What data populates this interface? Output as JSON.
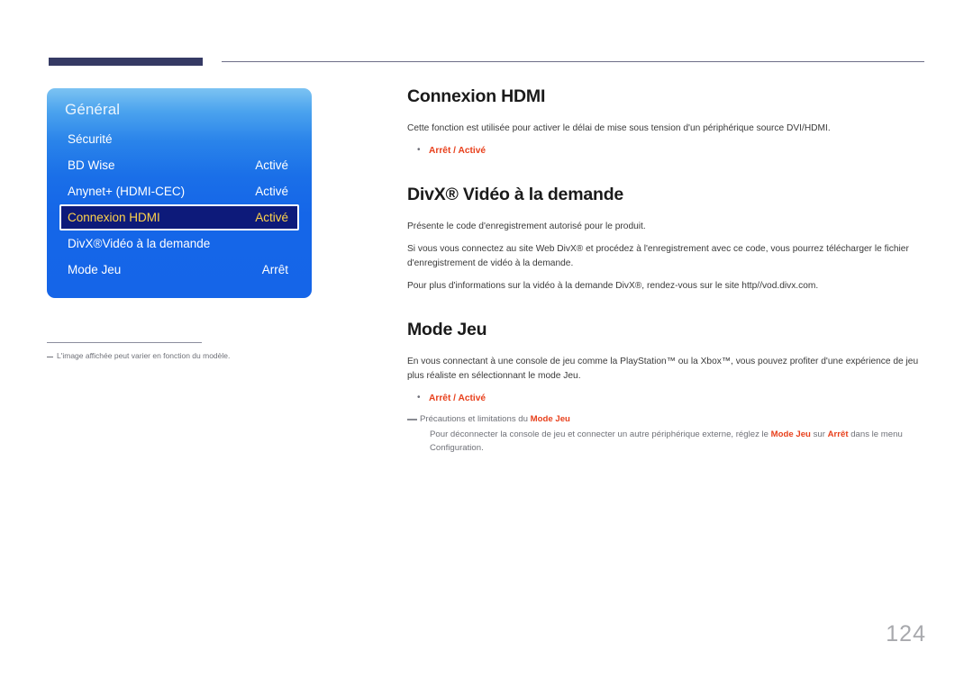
{
  "page": {
    "number": "124"
  },
  "osd": {
    "title": "Général",
    "rows": [
      {
        "label": "Sécurité",
        "value": "",
        "selected": false
      },
      {
        "label": "BD Wise",
        "value": "Activé",
        "selected": false
      },
      {
        "label": "Anynet+ (HDMI-CEC)",
        "value": "Activé",
        "selected": false
      },
      {
        "label": "Connexion HDMI",
        "value": "Activé",
        "selected": true
      },
      {
        "label": "DivX®Vidéo à la demande",
        "value": "",
        "selected": false
      },
      {
        "label": "Mode Jeu",
        "value": "Arrêt",
        "selected": false
      }
    ],
    "footnote": "L'image affichée peut varier en fonction du modèle.",
    "colors": {
      "panel_top": "#7cc3f2",
      "panel_bottom": "#1565e8",
      "selected_bg": "#0d1a7a",
      "selected_text": "#ffd24a"
    }
  },
  "sections": {
    "hdmi": {
      "heading": "Connexion HDMI",
      "paragraph": "Cette fonction est utilisée pour activer le délai de mise sous tension d'un périphérique source DVI/HDMI.",
      "bullet": "Arrêt / Activé"
    },
    "divx": {
      "heading": "DivX® Vidéo à la demande",
      "paragraph1": "Présente le code d'enregistrement autorisé pour le produit.",
      "paragraph2": "Si vous vous connectez au site Web DivX® et procédez à l'enregistrement avec ce code, vous pourrez télécharger le fichier d'enregistrement de vidéo à la demande.",
      "paragraph3": "Pour plus d'informations sur la vidéo à la demande DivX®, rendez-vous sur le site http//vod.divx.com."
    },
    "game": {
      "heading": "Mode Jeu",
      "paragraph": "En vous connectant à une console de jeu comme la PlayStation™ ou la Xbox™, vous pouvez profiter d'une expérience de jeu plus réaliste en sélectionnant le mode Jeu.",
      "bullet": "Arrêt / Activé",
      "note_head_prefix": "Précautions et limitations du ",
      "note_head_keyword": "Mode Jeu",
      "note_body_1": "Pour déconnecter la console de jeu et connecter un autre périphérique externe, réglez le ",
      "note_body_kw1": "Mode Jeu",
      "note_body_2": " sur ",
      "note_body_kw2": "Arrêt",
      "note_body_3": " dans le menu Configuration."
    }
  },
  "theme": {
    "accent": "#e8401c",
    "rule_dark": "#353a64",
    "text": "#231f20"
  }
}
